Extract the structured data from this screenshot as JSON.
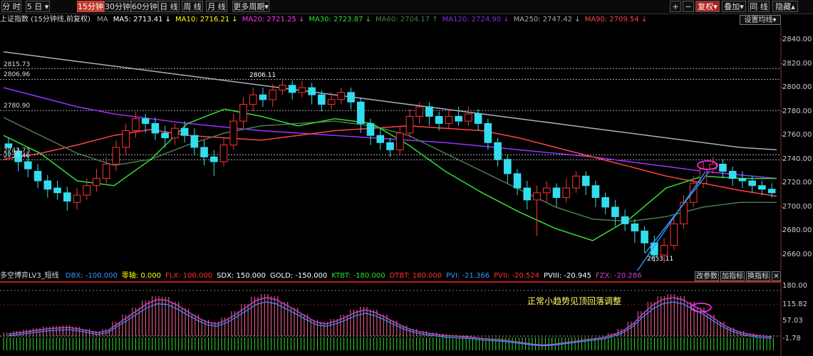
{
  "toolbar": {
    "tabs": [
      {
        "label": "分 时",
        "active": false
      },
      {
        "label": "5 日",
        "active": false,
        "dropdown": true
      },
      {
        "label": "15分钟",
        "active": true
      },
      {
        "label": "30分钟",
        "active": false
      },
      {
        "label": "60分钟",
        "active": false
      },
      {
        "label": "日 线",
        "active": false
      },
      {
        "label": "周 线",
        "active": false
      },
      {
        "label": "月 线",
        "active": false
      },
      {
        "label": "更多周期",
        "active": false,
        "dropdown": true
      }
    ],
    "right": {
      "plus": "+",
      "minus": "−",
      "fuquan": "复权",
      "dieja": "叠加",
      "tongxian": "同 线",
      "yincang": "隐藏"
    }
  },
  "title": "上证指数 (15分钟线,前复权)",
  "ma_line": {
    "ma_label": "MA",
    "items": [
      {
        "text": "MA5: 2713.41",
        "arrow": "↓",
        "color": "#ffffff"
      },
      {
        "text": "MA10: 2716.21",
        "arrow": "↓",
        "color": "#ffff00"
      },
      {
        "text": "MA20: 2721.25",
        "arrow": "↓",
        "color": "#ff33ff"
      },
      {
        "text": "MA30: 2723.87",
        "arrow": "↓",
        "color": "#33dd33"
      },
      {
        "text": "MA60: 2704.17",
        "arrow": "↑",
        "color": "#4c7a4c"
      },
      {
        "text": "MA120: 2724.90",
        "arrow": "↓",
        "color": "#8a2be2"
      },
      {
        "text": "MA250: 2747.42",
        "arrow": "↓",
        "color": "#aaaaaa"
      },
      {
        "text": "MA90: 2709.54",
        "arrow": "↓",
        "color": "#ff4444"
      }
    ],
    "settings_button": "设置均线"
  },
  "price_axis": [
    "2840.00",
    "2820.00",
    "2800.00",
    "2780.00",
    "2760.00",
    "2740.00",
    "2720.00",
    "2700.00",
    "2680.00",
    "2660.00"
  ],
  "levels": [
    "2815.73",
    "2806.96",
    "2780.90",
    "2743.73",
    "2739.46"
  ],
  "annotations": {
    "high": "2806.11",
    "low": "2653.11",
    "comment": "正常小趋势见顶回落调整"
  },
  "indicator": {
    "name": "多空博弈LV3_短线",
    "items": [
      {
        "text": "DBX: -100.000",
        "color": "#3399ff"
      },
      {
        "text": "零轴: 0.000",
        "color": "#ffff00"
      },
      {
        "text": "FLX: 100.000",
        "color": "#ff3333"
      },
      {
        "text": "SDX: 150.000",
        "color": "#ffffff"
      },
      {
        "text": "GOLD: -150.000",
        "color": "#ffffff"
      },
      {
        "text": "KTBT: -180.000",
        "color": "#33dd33"
      },
      {
        "text": "DTBT: 180.000",
        "color": "#ff3333"
      },
      {
        "text": "PVI: -21.366",
        "color": "#3399ff"
      },
      {
        "text": "PVII: -20.524",
        "color": "#ff3333"
      },
      {
        "text": "PVIII: -20.945",
        "color": "#ffffff"
      },
      {
        "text": "FZX: -20.286",
        "color": "#cc44cc"
      }
    ],
    "buttons": {
      "params": "改参数",
      "add": "加指标",
      "switch": "换指标",
      "close": "✕"
    },
    "axis": [
      "180.00",
      "115.82",
      "57.03",
      "-1.78"
    ]
  },
  "chart_data": {
    "type": "candlestick",
    "ylim": [
      2650,
      2850
    ],
    "candles": [
      [
        2753,
        2750,
        2758,
        2742
      ],
      [
        2747,
        2738,
        2750,
        2730
      ],
      [
        2738,
        2732,
        2744,
        2725
      ],
      [
        2730,
        2722,
        2736,
        2716
      ],
      [
        2722,
        2715,
        2727,
        2708
      ],
      [
        2716,
        2712,
        2722,
        2706
      ],
      [
        2712,
        2705,
        2717,
        2697
      ],
      [
        2704,
        2710,
        2716,
        2698
      ],
      [
        2710,
        2718,
        2724,
        2706
      ],
      [
        2718,
        2724,
        2732,
        2713
      ],
      [
        2724,
        2736,
        2742,
        2720
      ],
      [
        2736,
        2750,
        2756,
        2730
      ],
      [
        2750,
        2764,
        2770,
        2744
      ],
      [
        2764,
        2774,
        2780,
        2758
      ],
      [
        2774,
        2770,
        2778,
        2762
      ],
      [
        2770,
        2762,
        2775,
        2756
      ],
      [
        2762,
        2758,
        2768,
        2750
      ],
      [
        2758,
        2766,
        2770,
        2752
      ],
      [
        2766,
        2760,
        2772,
        2754
      ],
      [
        2760,
        2750,
        2766,
        2744
      ],
      [
        2750,
        2742,
        2756,
        2735
      ],
      [
        2742,
        2738,
        2748,
        2726
      ],
      [
        2738,
        2752,
        2758,
        2734
      ],
      [
        2752,
        2772,
        2778,
        2748
      ],
      [
        2772,
        2786,
        2792,
        2766
      ],
      [
        2786,
        2794,
        2800,
        2780
      ],
      [
        2794,
        2790,
        2800,
        2784
      ],
      [
        2790,
        2798,
        2803,
        2784
      ],
      [
        2798,
        2802,
        2806,
        2794
      ],
      [
        2802,
        2796,
        2806,
        2790
      ],
      [
        2796,
        2800,
        2806,
        2792
      ],
      [
        2800,
        2794,
        2804,
        2786
      ],
      [
        2794,
        2786,
        2798,
        2780
      ],
      [
        2786,
        2790,
        2796,
        2782
      ],
      [
        2790,
        2796,
        2800,
        2786
      ],
      [
        2796,
        2788,
        2800,
        2782
      ],
      [
        2788,
        2770,
        2792,
        2762
      ],
      [
        2770,
        2760,
        2774,
        2752
      ],
      [
        2760,
        2754,
        2766,
        2748
      ],
      [
        2754,
        2748,
        2758,
        2742
      ],
      [
        2748,
        2762,
        2768,
        2744
      ],
      [
        2762,
        2776,
        2782,
        2758
      ],
      [
        2776,
        2784,
        2788,
        2770
      ],
      [
        2784,
        2776,
        2788,
        2768
      ],
      [
        2776,
        2770,
        2780,
        2764
      ],
      [
        2770,
        2776,
        2782,
        2766
      ],
      [
        2776,
        2772,
        2784,
        2768
      ],
      [
        2772,
        2778,
        2784,
        2768
      ],
      [
        2778,
        2770,
        2782,
        2764
      ],
      [
        2770,
        2754,
        2774,
        2748
      ],
      [
        2754,
        2740,
        2758,
        2734
      ],
      [
        2740,
        2728,
        2744,
        2720
      ],
      [
        2728,
        2716,
        2732,
        2710
      ],
      [
        2716,
        2706,
        2722,
        2698
      ],
      [
        2706,
        2712,
        2718,
        2676
      ],
      [
        2712,
        2716,
        2722,
        2704
      ],
      [
        2716,
        2708,
        2720,
        2700
      ],
      [
        2708,
        2716,
        2724,
        2704
      ],
      [
        2716,
        2726,
        2730,
        2712
      ],
      [
        2726,
        2718,
        2730,
        2710
      ],
      [
        2718,
        2708,
        2722,
        2700
      ],
      [
        2708,
        2700,
        2712,
        2694
      ],
      [
        2700,
        2692,
        2706,
        2684
      ],
      [
        2692,
        2686,
        2698,
        2680
      ],
      [
        2686,
        2680,
        2690,
        2670
      ],
      [
        2680,
        2670,
        2684,
        2662
      ],
      [
        2670,
        2660,
        2676,
        2654
      ],
      [
        2660,
        2668,
        2674,
        2653
      ],
      [
        2668,
        2686,
        2692,
        2664
      ],
      [
        2686,
        2704,
        2710,
        2682
      ],
      [
        2704,
        2720,
        2726,
        2700
      ],
      [
        2720,
        2732,
        2738,
        2716
      ],
      [
        2732,
        2736,
        2742,
        2728
      ],
      [
        2736,
        2730,
        2740,
        2724
      ],
      [
        2730,
        2724,
        2734,
        2718
      ],
      [
        2724,
        2722,
        2730,
        2716
      ],
      [
        2722,
        2718,
        2726,
        2712
      ],
      [
        2718,
        2715,
        2722,
        2710
      ],
      [
        2715,
        2712,
        2720,
        2708
      ]
    ],
    "ma_lines": [
      {
        "name": "MA250",
        "color": "#a8b0c0",
        "values": [
          2830,
          2826,
          2822,
          2818,
          2814,
          2810,
          2806,
          2802,
          2798,
          2794,
          2790,
          2786,
          2782,
          2778,
          2774,
          2770,
          2766,
          2762,
          2758,
          2754,
          2750,
          2748
        ]
      },
      {
        "name": "MA120",
        "color": "#9933ff",
        "values": [
          2800,
          2792,
          2784,
          2778,
          2774,
          2770,
          2767,
          2764,
          2762,
          2760,
          2758,
          2756,
          2754,
          2751,
          2748,
          2745,
          2742,
          2738,
          2734,
          2730,
          2727,
          2724
        ]
      },
      {
        "name": "MA90",
        "color": "#ff4444",
        "values": [
          2740,
          2745,
          2752,
          2760,
          2765,
          2760,
          2758,
          2756,
          2760,
          2764,
          2766,
          2768,
          2766,
          2764,
          2758,
          2750,
          2742,
          2734,
          2726,
          2720,
          2714,
          2709
        ]
      },
      {
        "name": "MA60",
        "color": "#4c7a4c",
        "values": [
          2775,
          2760,
          2745,
          2735,
          2740,
          2752,
          2762,
          2768,
          2770,
          2772,
          2768,
          2760,
          2745,
          2730,
          2715,
          2700,
          2690,
          2688,
          2692,
          2700,
          2704,
          2704
        ]
      },
      {
        "name": "MA30",
        "color": "#33dd33",
        "values": [
          2760,
          2745,
          2722,
          2718,
          2740,
          2770,
          2782,
          2776,
          2768,
          2774,
          2770,
          2752,
          2730,
          2712,
          2696,
          2682,
          2672,
          2690,
          2716,
          2726,
          2724,
          2724
        ]
      }
    ],
    "indicator_bars": [
      10,
      14,
      18,
      22,
      26,
      28,
      30,
      26,
      20,
      14,
      20,
      40,
      60,
      80,
      100,
      112,
      110,
      96,
      78,
      60,
      46,
      40,
      52,
      70,
      90,
      110,
      118,
      112,
      96,
      80,
      62,
      46,
      40,
      48,
      60,
      74,
      82,
      74,
      60,
      44,
      30,
      20,
      14,
      10,
      6,
      4,
      2,
      0,
      -4,
      -6,
      -8,
      -12,
      -16,
      -20,
      -22,
      -20,
      -16,
      -12,
      -8,
      -4,
      0,
      8,
      20,
      40,
      70,
      96,
      112,
      118,
      112,
      96,
      80,
      60,
      40,
      24,
      14,
      8,
      4,
      2
    ]
  }
}
